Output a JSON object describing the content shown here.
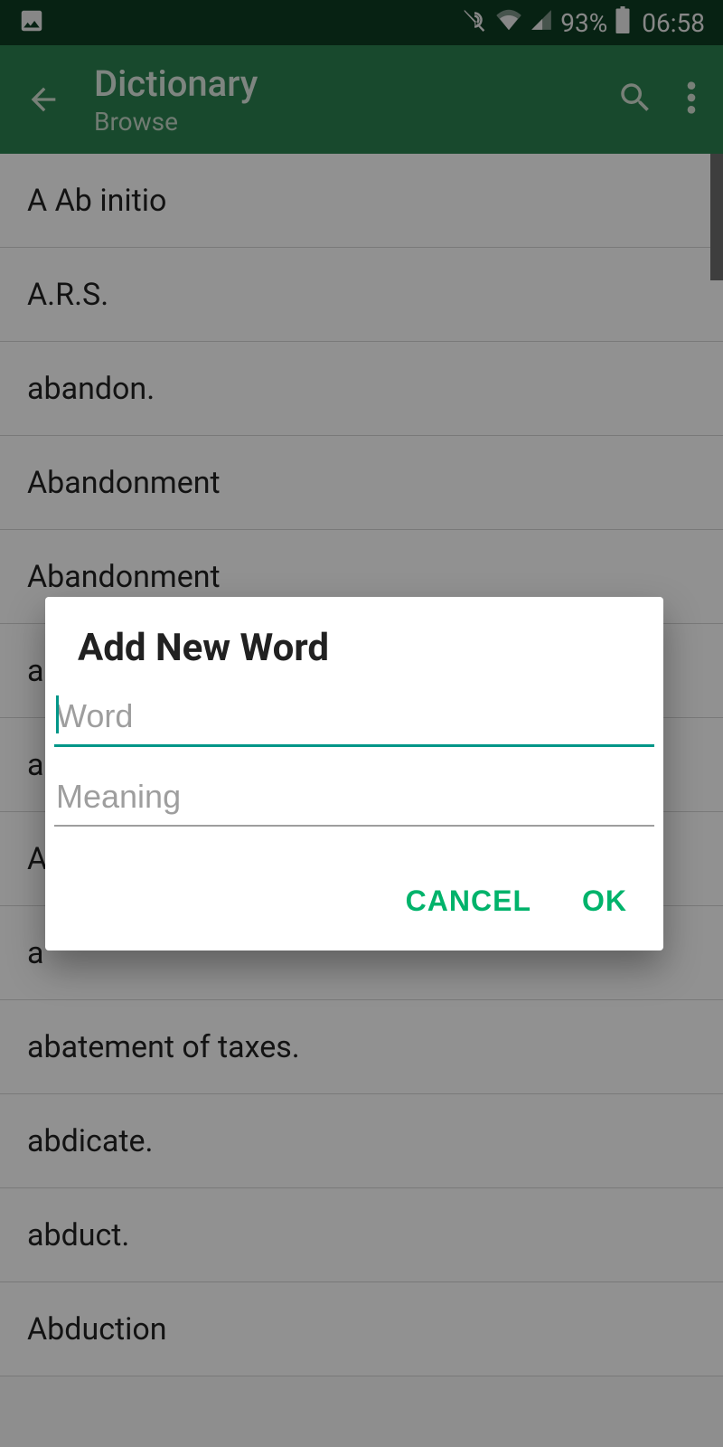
{
  "status": {
    "battery": "93%",
    "time": "06:58"
  },
  "appbar": {
    "title": "Dictionary",
    "subtitle": "Browse"
  },
  "list": {
    "items": [
      "A Ab initio",
      "A.R.S.",
      "abandon.",
      "Abandonment",
      "Abandonment",
      "a",
      "a",
      "A",
      "a",
      "abatement of taxes.",
      "abdicate.",
      "abduct.",
      "Abduction"
    ]
  },
  "dialog": {
    "title": "Add New Word",
    "word_placeholder": "Word",
    "word_value": "",
    "meaning_placeholder": "Meaning",
    "meaning_value": "",
    "cancel": "CANCEL",
    "ok": "OK"
  }
}
